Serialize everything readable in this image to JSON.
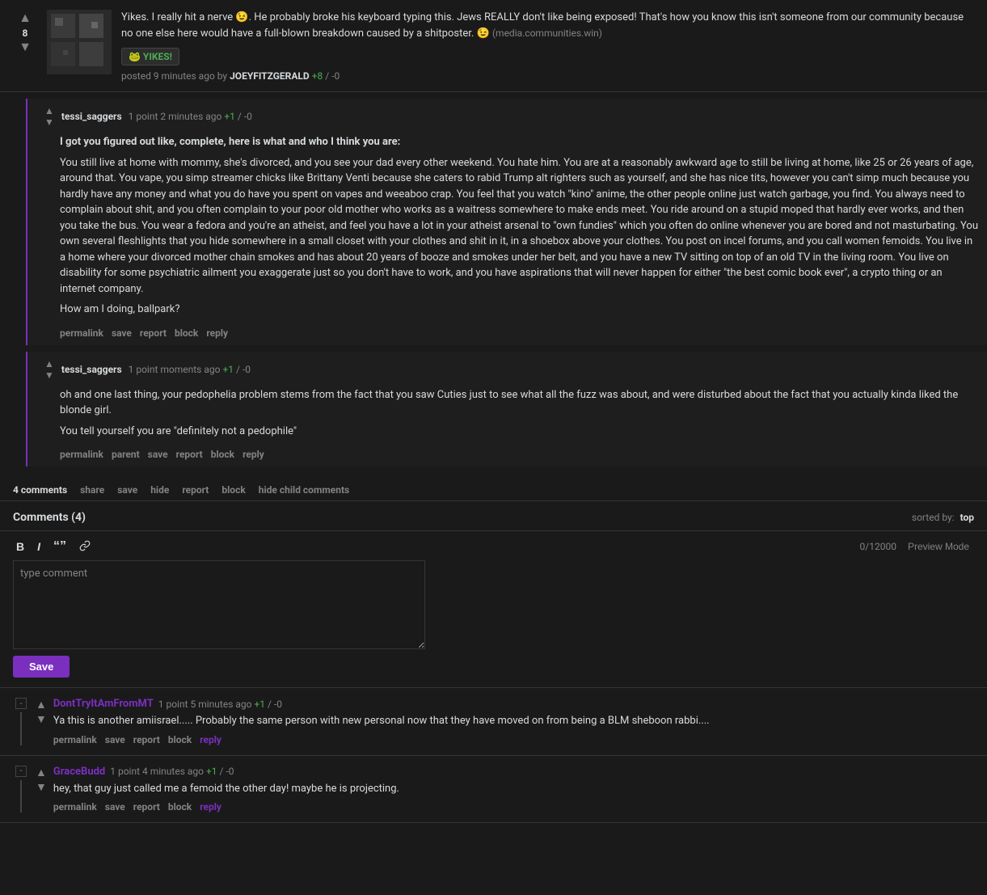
{
  "mainPost": {
    "voteCount": "8",
    "text": "Yikes. I really hit a nerve 😉. He probably broke his keyboard typing this. Jews REALLY don't like being exposed! That's how you know this isn't someone from our community because no one else here would have a full-blown breakdown caused by a shitposter. 😉",
    "domain": "(media.communities.win)",
    "badgeText": "🐸 YIKES!",
    "postedAgo": "posted 9 minutes ago by",
    "author": "JOEYFITZGERALD",
    "scorePos": "+8",
    "scoreNeg": "-0"
  },
  "nestedComments": [
    {
      "id": "nc1",
      "author": "tessi_saggers",
      "points": "1 point",
      "timeAgo": "2 minutes ago",
      "scorePos": "+1",
      "scoreNeg": "-0",
      "body": "I got you figured out like, complete, here is what and who I think you are:\n\nYou still live at home with mommy, she's divorced, and you see your dad every other weekend. You hate him. You are at a reasonably awkward age to still be living at home, like 25 or 26 years of age, around that. You vape, you simp streamer chicks like Brittany Venti because she caters to rabid Trump alt righters such as yourself, and she has nice tits, however you can't simp much because you hardly have any money and what you do have you spent on vapes and weeaboo crap. You feel that you watch \"kino\" anime, the other people online just watch garbage, you find. You always need to complain about shit, and you often complain to your poor old mother who works as a waitress somewhere to make ends meet. You ride around on a stupid moped that hardly ever works, and then you take the bus. You wear a fedora and you're an atheist, and feel you have a lot in your atheist arsenal to \"own fundies\" which you often do online whenever you are bored and not masturbating. You own several fleshlights that you hide somewhere in a small closet with your clothes and shit in it, in a shoebox above your clothes. You post on incel forums, and you call women femoids. You live in a home where your divorced mother chain smokes and has about 20 years of booze and smokes under her belt, and you have a new TV sitting on top of an old TV in the living room. You live on disability for some psychiatric ailment you exaggerate just so you don't have to work, and you have aspirations that will never happen for either \"the best comic book ever\", a crypto thing or an internet company.\n\nHow am I doing, ballpark?",
      "actions": [
        "permalink",
        "save",
        "report",
        "block",
        "reply"
      ]
    },
    {
      "id": "nc2",
      "author": "tessi_saggers",
      "points": "1 point",
      "timeAgo": "moments ago",
      "scorePos": "+1",
      "scoreNeg": "-0",
      "body": "oh and one last thing, your pedophelia problem stems from the fact that you saw Cuties just to see what all the fuzz was about, and were disturbed about the fact that you actually kinda liked the blonde girl.\n\nYou tell yourself you are \"definitely not a pedophile\"",
      "actions": [
        "permalink",
        "parent",
        "save",
        "report",
        "block",
        "reply"
      ]
    }
  ],
  "postActions": {
    "commentsCount": "4 comments",
    "share": "share",
    "save": "save",
    "hide": "hide",
    "report": "report",
    "block": "block",
    "hideChildComments": "hide child comments"
  },
  "commentSection": {
    "title": "Comments (4)",
    "sortedBy": "sorted by:",
    "sortMode": "top",
    "toolbar": {
      "bold": "B",
      "italic": "I",
      "quote": "“”",
      "link": "🔗"
    },
    "charCount": "0/12000",
    "previewMode": "Preview Mode",
    "placeholder": "type comment",
    "saveLabel": "Save"
  },
  "topComments": [
    {
      "id": "tc1",
      "author": "DontTryItAmFromMT",
      "points": "1 point",
      "timeAgo": "5 minutes ago",
      "scorePos": "+1",
      "scoreNeg": "-0",
      "body": "Ya this is another amiisrael..... Probably the same person with new personal now that they have moved on from being a BLM sheboon rabbi....",
      "actions": [
        "permalink",
        "save",
        "report",
        "block"
      ],
      "replyLabel": "reply"
    },
    {
      "id": "tc2",
      "author": "GraceBudd",
      "points": "1 point",
      "timeAgo": "4 minutes ago",
      "scorePos": "+1",
      "scoreNeg": "-0",
      "body": "hey, that guy just called me a femoid the other day! maybe he is projecting.",
      "actions": [
        "permalink",
        "save",
        "report",
        "block"
      ],
      "replyLabel": "reply"
    }
  ],
  "colors": {
    "accent": "#7b2fbe",
    "bg": "#1a1a1b",
    "text": "#d7dadc",
    "muted": "#818384",
    "border": "#343536",
    "commentBg": "#1e1e1f"
  }
}
